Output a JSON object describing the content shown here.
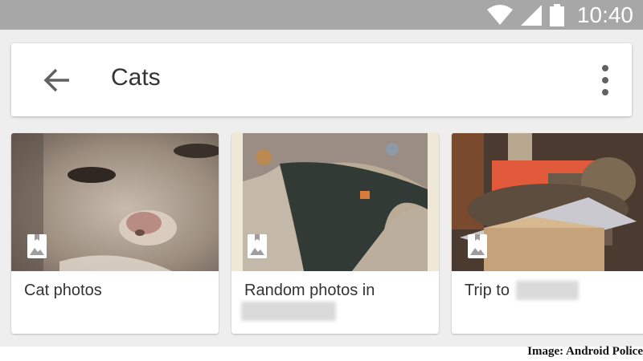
{
  "status_bar": {
    "time": "10:40",
    "icons": [
      "wifi-icon",
      "signal-icon",
      "battery-icon"
    ]
  },
  "toolbar": {
    "back_icon": "arrow-back-icon",
    "title": "Cats",
    "menu_icon": "more-vert-icon"
  },
  "albums": [
    {
      "title": "Cat photos",
      "icon": "album-icon"
    },
    {
      "title": "Random photos in",
      "icon": "album-icon"
    },
    {
      "title": "Trip to",
      "icon": "album-icon"
    }
  ],
  "credit": "Image: Android Police",
  "colors": {
    "status_bar": "#a7a7a7",
    "background": "#eeeeee",
    "card": "#ffffff",
    "text": "#333333",
    "icon": "#616161"
  }
}
